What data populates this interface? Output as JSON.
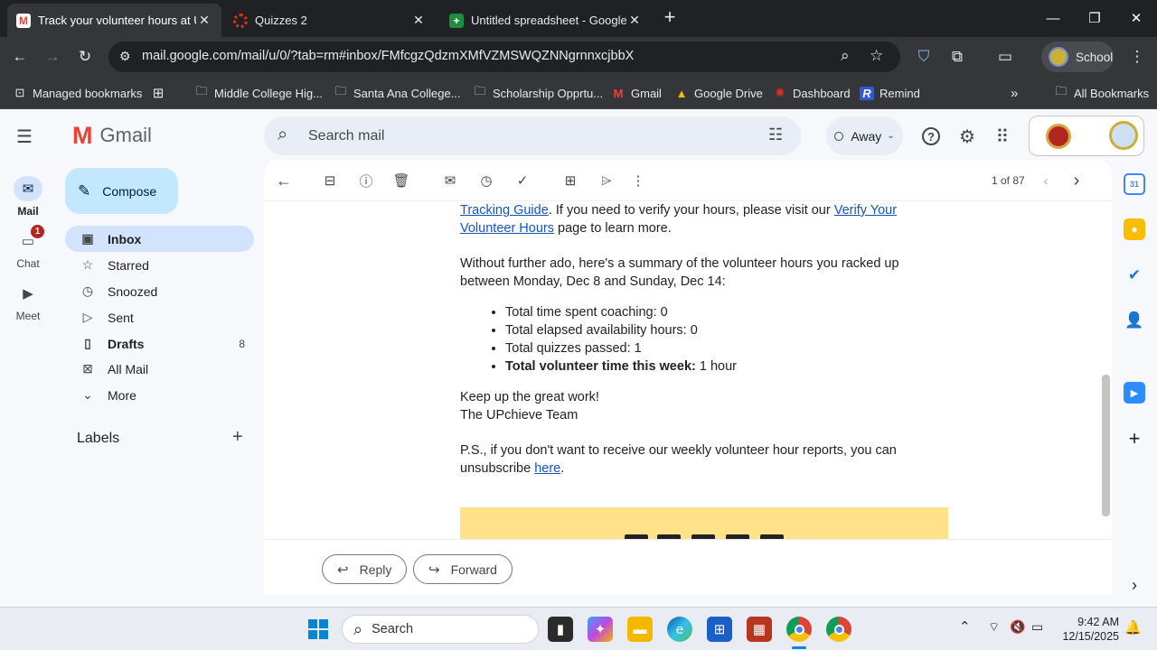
{
  "browser": {
    "tabs": [
      {
        "title": "Track your volunteer hours at U",
        "favicon": "gmail-favicon",
        "active": true
      },
      {
        "title": "Quizzes 2",
        "favicon": "canvas-favicon",
        "active": false
      },
      {
        "title": "Untitled spreadsheet - Google S",
        "favicon": "sheets-favicon",
        "active": false
      }
    ],
    "new_tab": "+",
    "url": "mail.google.com/mail/u/0/?tab=rm#inbox/FMfcgzQdzmXMfVZMSWQZNNgrnnxcjbbX",
    "profile_label": "School",
    "window_controls": {
      "minimize": "—",
      "restore": "❐",
      "close": "✕"
    }
  },
  "bookmarks": {
    "items": [
      {
        "label": "Managed bookmarks",
        "icon": "managed-bookmarks-icon"
      },
      {
        "label": "Middle College Hig...",
        "icon": "folder-icon"
      },
      {
        "label": "Santa Ana College...",
        "icon": "folder-icon"
      },
      {
        "label": "Scholarship Opprtu...",
        "icon": "folder-icon"
      },
      {
        "label": "Gmail",
        "icon": "gmail-icon"
      },
      {
        "label": "Google Drive",
        "icon": "drive-icon"
      },
      {
        "label": "Dashboard",
        "icon": "dashboard-icon"
      },
      {
        "label": "Remind",
        "icon": "remind-icon"
      }
    ],
    "overflow": "»",
    "all_bookmarks": "All Bookmarks"
  },
  "gmail": {
    "logo_text": "Gmail",
    "search_placeholder": "Search mail",
    "status": "Away",
    "rail": [
      {
        "label": "Mail",
        "icon": "mail-icon",
        "badge": ""
      },
      {
        "label": "Chat",
        "icon": "chat-icon",
        "badge": "1"
      },
      {
        "label": "Meet",
        "icon": "video-icon",
        "badge": ""
      }
    ],
    "compose_label": "Compose",
    "nav": [
      {
        "label": "Inbox",
        "icon": "inbox-icon",
        "count": ""
      },
      {
        "label": "Starred",
        "icon": "star-icon",
        "count": ""
      },
      {
        "label": "Snoozed",
        "icon": "clock-icon",
        "count": ""
      },
      {
        "label": "Sent",
        "icon": "send-icon",
        "count": ""
      },
      {
        "label": "Drafts",
        "icon": "draft-icon",
        "count": "8"
      },
      {
        "label": "All Mail",
        "icon": "all-mail-icon",
        "count": ""
      },
      {
        "label": "More",
        "icon": "chevron-down-icon",
        "count": ""
      }
    ],
    "labels_heading": "Labels",
    "pagination": "1 of 87",
    "email": {
      "para1_link1": "Tracking Guide",
      "para1_mid": ". If you need to verify your hours, please visit our ",
      "para1_link2a": "Verify Your",
      "para1_link2b": "Volunteer Hours",
      "para1_end": " page to learn more.",
      "para2_line1": "Without further ado, here's a summary of the volunteer hours you racked up",
      "para2_line2": "between Monday, Dec 8 and Sunday, Dec 14:",
      "bullets": [
        "Total time spent coaching: 0",
        "Total elapsed availability hours: 0",
        "Total quizzes passed: 1"
      ],
      "bullet_bold": "Total volunteer time this week:",
      "bullet_bold_value": " 1 hour",
      "signoff1": "Keep up the great work!",
      "signoff2": "The UPchieve Team",
      "ps_line1": "P.S., if you don't want to receive our weekly volunteer hour reports, you can",
      "ps_line2_pre": "unsubscribe ",
      "ps_link": "here",
      "ps_end": "."
    },
    "reply_label": "Reply",
    "forward_label": "Forward"
  },
  "taskbar": {
    "search_label": "Search",
    "time": "9:42 AM",
    "date": "12/15/2025"
  },
  "colors": {
    "compose_bg": "#c2e7ff",
    "inbox_selected": "#d3e3fd",
    "footer_yellow": "#ffe28a",
    "link": "#1155cc"
  }
}
